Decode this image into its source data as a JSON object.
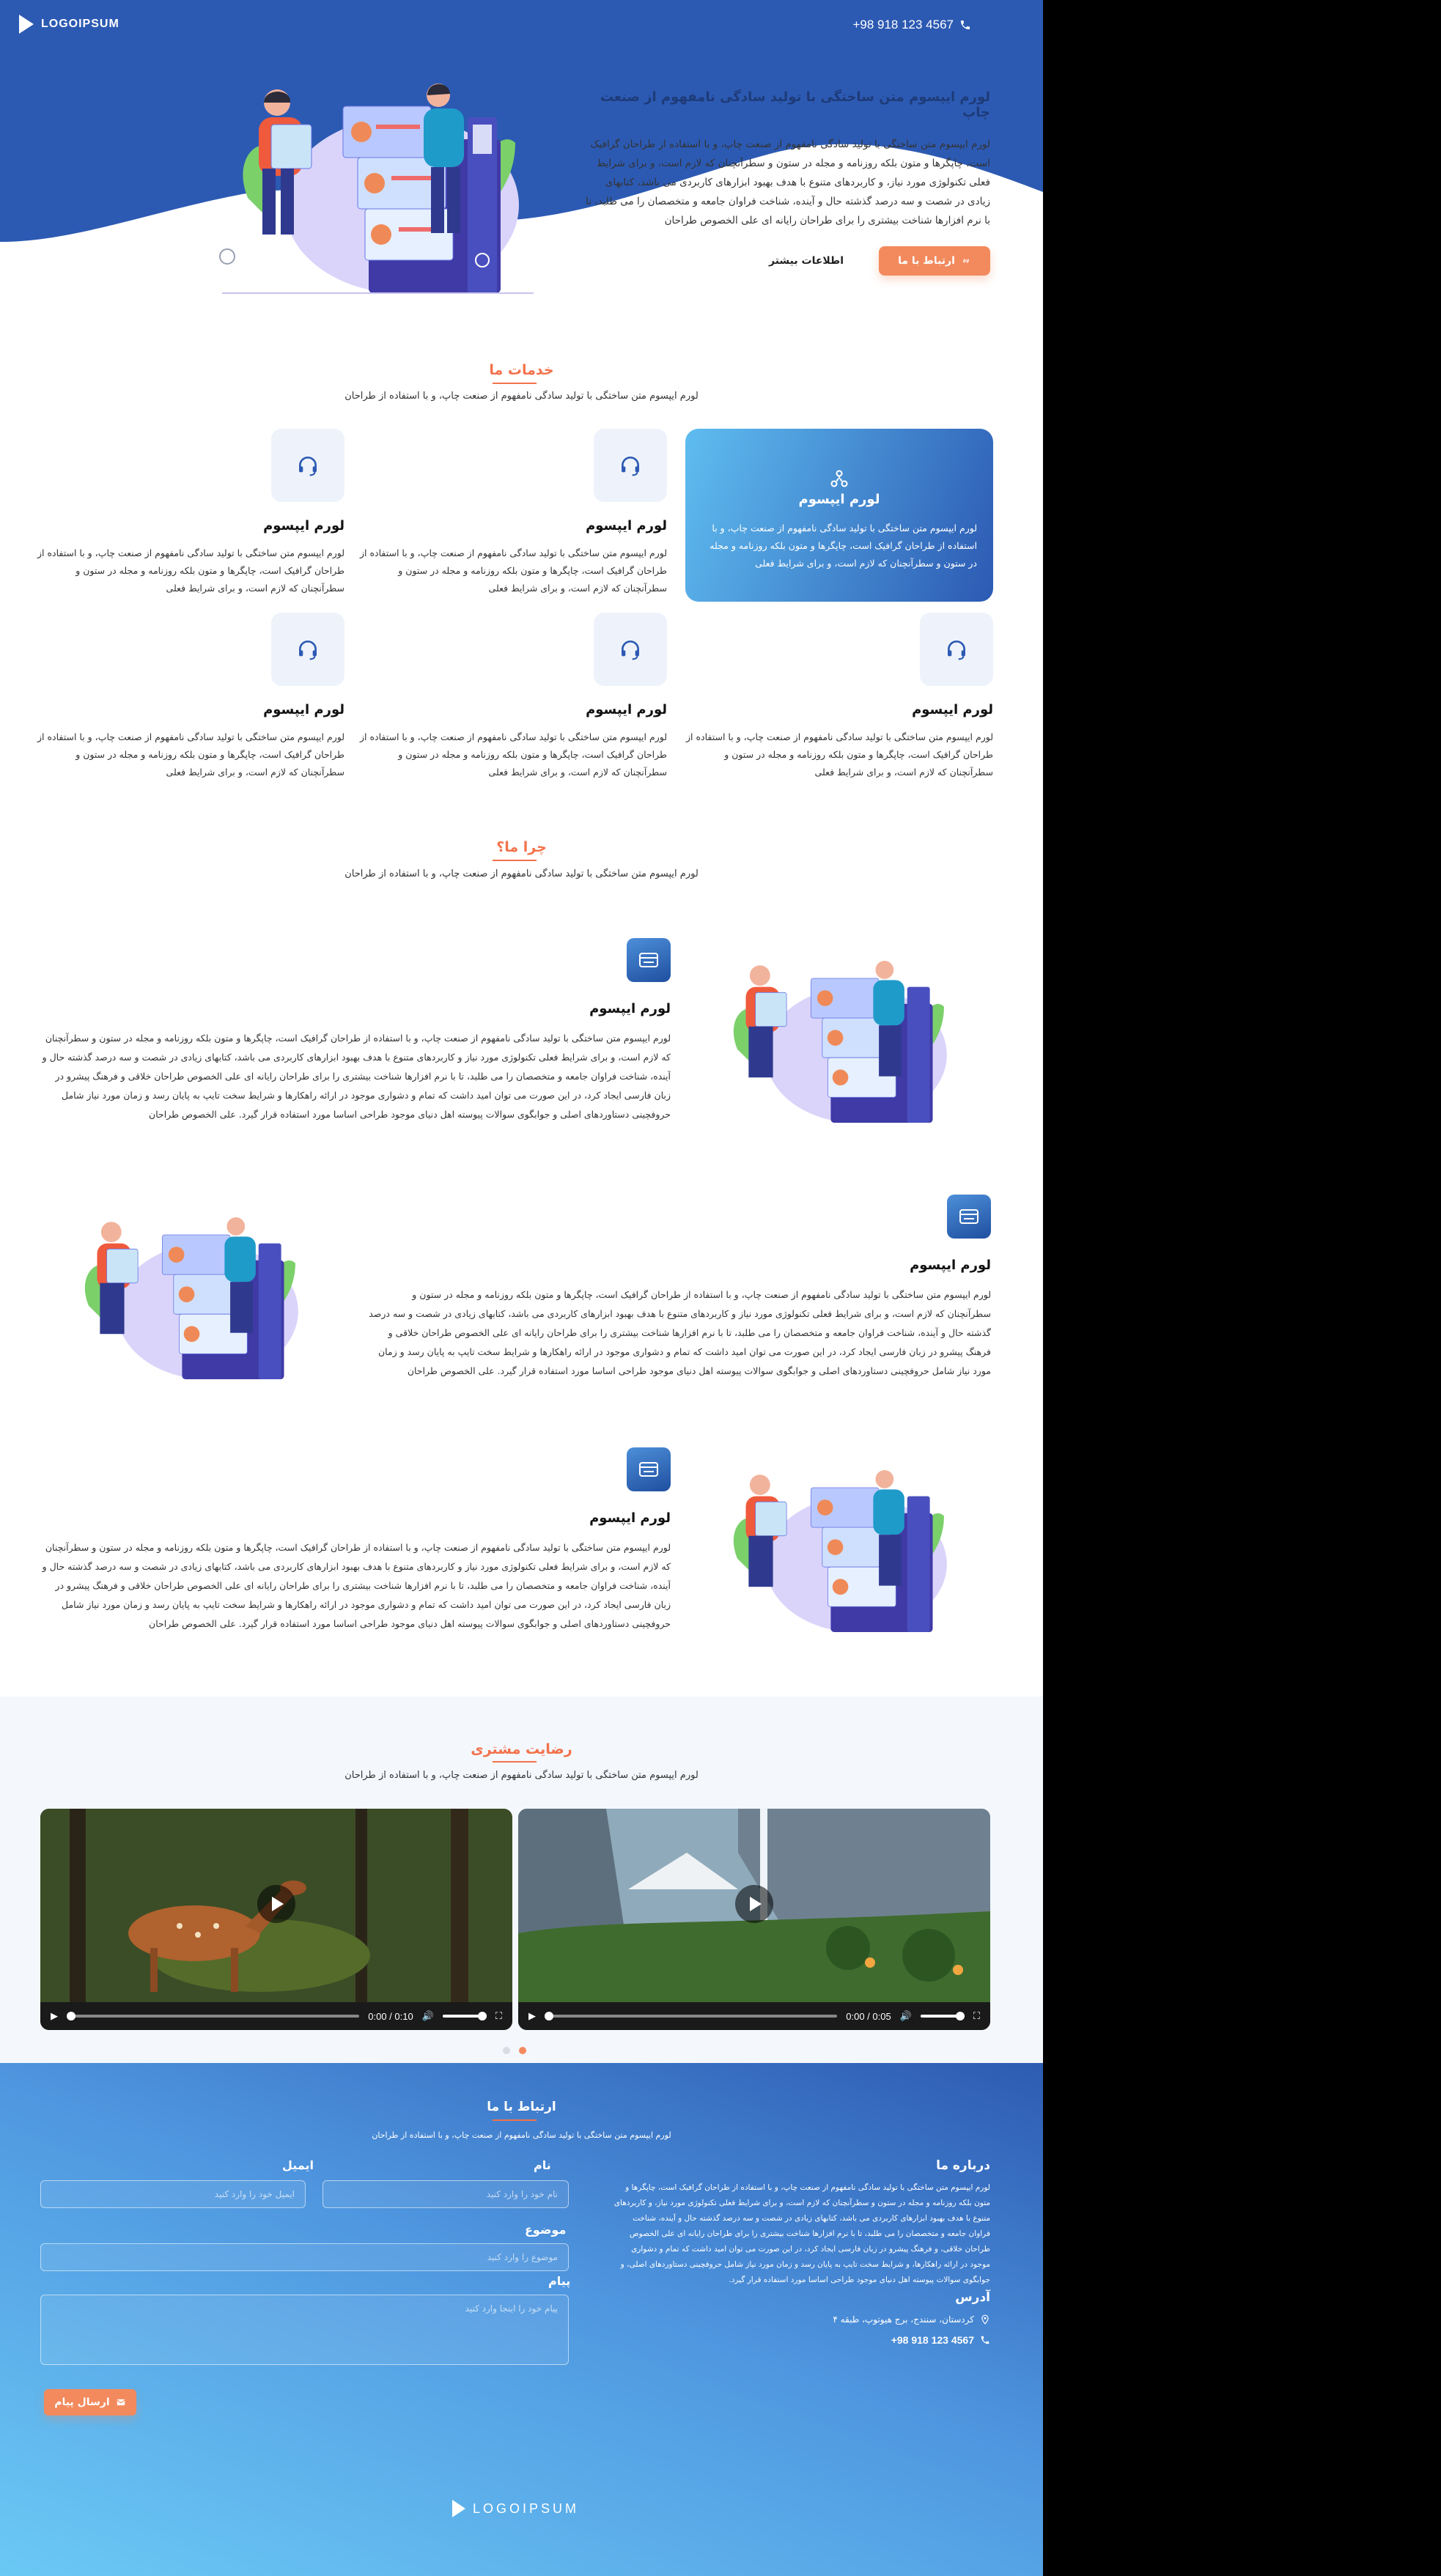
{
  "header": {
    "logo_text": "LOGOIPSUM",
    "phone": "+98 918 123 4567"
  },
  "hero": {
    "title": "لورم ایپسوم متن ساختگی با تولید سادگی نامفهوم از صنعت چاپ",
    "description": "لورم ایپسوم متن ساختگی با تولید سادگی نامفهوم از صنعت چاپ، و با استفاده از طراحان گرافیک است، چاپگرها و متون بلکه روزنامه و مجله در ستون و سطرآنچنان که لازم است، و برای شرایط فعلی تکنولوژی مورد نیاز، و کاربردهای متنوع با هدف بهبود ابزارهای کاربردی می باشد، کتابهای زیادی در شصت و سه درصد گذشته حال و آینده، شناخت فراوان جامعه و متخصصان را می طلبد، تا با نرم افزارها شناخت بیشتری را برای طراحان رایانه ای علی الخصوص طراحان",
    "contact_button": "ارتباط با ما",
    "more_button": "اطلاعات بیشتر"
  },
  "services": {
    "title": "خدمات ما",
    "subtitle": "لورم ایپسوم متن ساختگی با تولید سادگی نامفهوم از صنعت چاپ، و با استفاده از طراحان",
    "items": [
      {
        "title": "لورم ایپسوم",
        "text": "لورم ایپسوم متن ساختگی با تولید سادگی نامفهوم از صنعت چاپ، و با استفاده از طراحان گرافیک است، چاپگرها و متون بلکه روزنامه و مجله در ستون و سطرآنچنان که لازم است، و برای شرایط فعلی",
        "icon": "network-icon"
      },
      {
        "title": "لورم ایپسوم",
        "text": "لورم ایپسوم متن ساختگی با تولید سادگی نامفهوم از صنعت چاپ، و با استفاده از طراحان گرافیک است، چاپگرها و متون بلکه روزنامه و مجله در ستون و سطرآنچنان که لازم است، و برای شرایط فعلی",
        "icon": "headset-icon"
      },
      {
        "title": "لورم ایپسوم",
        "text": "لورم ایپسوم متن ساختگی با تولید سادگی نامفهوم از صنعت چاپ، و با استفاده از طراحان گرافیک است، چاپگرها و متون بلکه روزنامه و مجله در ستون و سطرآنچنان که لازم است، و برای شرایط فعلی",
        "icon": "headset-icon"
      },
      {
        "title": "لورم ایپسوم",
        "text": "لورم ایپسوم متن ساختگی با تولید سادگی نامفهوم از صنعت چاپ، و با استفاده از طراحان گرافیک است، چاپگرها و متون بلکه روزنامه و مجله در ستون و سطرآنچنان که لازم است، و برای شرایط فعلی",
        "icon": "headset-icon"
      },
      {
        "title": "لورم ایپسوم",
        "text": "لورم ایپسوم متن ساختگی با تولید سادگی نامفهوم از صنعت چاپ، و با استفاده از طراحان گرافیک است، چاپگرها و متون بلکه روزنامه و مجله در ستون و سطرآنچنان که لازم است، و برای شرایط فعلی",
        "icon": "headset-icon"
      },
      {
        "title": "لورم ایپسوم",
        "text": "لورم ایپسوم متن ساختگی با تولید سادگی نامفهوم از صنعت چاپ، و با استفاده از طراحان گرافیک است، چاپگرها و متون بلکه روزنامه و مجله در ستون و سطرآنچنان که لازم است، و برای شرایط فعلی",
        "icon": "headset-icon"
      }
    ]
  },
  "why": {
    "title": "چرا ما؟",
    "subtitle": "لورم ایپسوم متن ساختگی با تولید سادگی نامفهوم از صنعت چاپ، و با استفاده از طراحان",
    "items": [
      {
        "title": "لورم ایپسوم",
        "text": "لورم ایپسوم متن ساختگی با تولید سادگی نامفهوم از صنعت چاپ، و با استفاده از طراحان گرافیک است، چاپگرها و متون بلکه روزنامه و مجله در ستون و سطرآنچنان که لازم است، و برای شرایط فعلی تکنولوژی مورد نیاز و کاربردهای متنوع با هدف بهبود ابزارهای کاربردی می باشد، کتابهای زیادی در شصت و سه درصد گذشته حال و آینده، شناخت فراوان جامعه و متخصصان را می طلبد، تا با نرم افزارها شناخت بیشتری را برای طراحان رایانه ای علی الخصوص طراحان خلاقی و فرهنگ پیشرو در زبان فارسی ایجاد کرد، در این صورت می توان امید داشت که تمام و دشواری موجود در ارائه راهکارها و شرایط سخت تایپ به پایان رسد و زمان مورد نیاز شامل حروفچینی دستاوردهای اصلی و جوابگوی سوالات پیوسته اهل دنیای موجود طراحی اساسا مورد استفاده قرار گیرد. علی الخصوص طراحان"
      },
      {
        "title": "لورم ایپسوم",
        "text": "لورم ایپسوم متن ساختگی با تولید سادگی نامفهوم از صنعت چاپ، و با استفاده از طراحان گرافیک است، چاپگرها و متون بلکه روزنامه و مجله در ستون و سطرآنچنان که لازم است، و برای شرایط فعلی تکنولوژی مورد نیاز و کاربردهای متنوع با هدف بهبود ابزارهای کاربردی می باشد، کتابهای زیادی در شصت و سه درصد گذشته حال و آینده، شناخت فراوان جامعه و متخصصان را می طلبد، تا با نرم افزارها شناخت بیشتری را برای طراحان رایانه ای علی الخصوص طراحان خلاقی و فرهنگ پیشرو در زبان فارسی ایجاد کرد، در این صورت می توان امید داشت که تمام و دشواری موجود در ارائه راهکارها و شرایط سخت تایپ به پایان رسد و زمان مورد نیاز شامل حروفچینی دستاوردهای اصلی و جوابگوی سوالات پیوسته اهل دنیای موجود طراحی اساسا مورد استفاده قرار گیرد. علی الخصوص طراحان"
      },
      {
        "title": "لورم ایپسوم",
        "text": "لورم ایپسوم متن ساختگی با تولید سادگی نامفهوم از صنعت چاپ، و با استفاده از طراحان گرافیک است، چاپگرها و متون بلکه روزنامه و مجله در ستون و سطرآنچنان که لازم است، و برای شرایط فعلی تکنولوژی مورد نیاز و کاربردهای متنوع با هدف بهبود ابزارهای کاربردی می باشد، کتابهای زیادی در شصت و سه درصد گذشته حال و آینده، شناخت فراوان جامعه و متخصصان را می طلبد، تا با نرم افزارها شناخت بیشتری را برای طراحان رایانه ای علی الخصوص طراحان خلاقی و فرهنگ پیشرو در زبان فارسی ایجاد کرد، در این صورت می توان امید داشت که تمام و دشواری موجود در ارائه راهکارها و شرایط سخت تایپ به پایان رسد و زمان مورد نیاز شامل حروفچینی دستاوردهای اصلی و جوابگوی سوالات پیوسته اهل دنیای موجود طراحی اساسا مورد استفاده قرار گیرد. علی الخصوص طراحان"
      }
    ]
  },
  "testimonials": {
    "title": "رضایت مشتری",
    "subtitle": "لورم ایپسوم متن ساختگی با تولید سادگی نامفهوم از صنعت چاپ، و با استفاده از طراحان",
    "videos": [
      {
        "time": "0:00 / 0:10",
        "scene": "deer"
      },
      {
        "time": "0:00 / 0:05",
        "scene": "waterfall"
      }
    ]
  },
  "contact": {
    "title": "ارتباط با ما",
    "subtitle": "لورم ایپسوم متن ساختگی با تولید سادگی نامفهوم از صنعت چاپ، و با استفاده از طراحان",
    "about_title": "درباره ما",
    "about_text": "لورم ایپسوم متن ساختگی با تولید سادگی نامفهوم از صنعت چاپ، و با استفاده از طراحان گرافیک است، چاپگرها و متون بلکه روزنامه و مجله در ستون و سطرآنچنان که لازم است، و برای شرایط فعلی تکنولوژی مورد نیاز، و کاربردهای متنوع با هدف بهبود ابزارهای کاربردی می باشد، کتابهای زیادی در شصت و سه درصد گذشته حال و آینده، شناخت فراوان جامعه و متخصصان را می طلبد، تا با نرم افزارها شناخت بیشتری را برای طراحان رایانه ای علی الخصوص طراحان خلاقی، و فرهنگ پیشرو در زبان فارسی ایجاد کرد، در این صورت می توان امید داشت که تمام و دشواری موجود در ارائه راهکارها، و شرایط سخت تایپ به پایان رسد و زمان مورد نیاز شامل حروفچینی دستاوردهای اصلی، و جوابگوی سوالات پیوسته اهل دنیای موجود طراحی اساسا مورد استفاده قرار گیرد.",
    "address_title": "آدرس",
    "address": "کردستان، سنندج، برج هیوتوپ، طبقه ۴",
    "phone": "+98 918 123 4567",
    "form": {
      "name_label": "نام",
      "name_placeholder": "نام خود را وارد کنید",
      "email_label": "ایمیل",
      "email_placeholder": "ایمیل خود را وارد کنید",
      "subject_label": "موضوع",
      "subject_placeholder": "موضوع را وارد کنید",
      "message_label": "پیام",
      "message_placeholder": "پیام خود را اینجا وارد کنید",
      "send_button": "ارسال پیام"
    },
    "footer_logo": "LOGOIPSUM"
  },
  "colors": {
    "primary_blue": "#2c5ab3",
    "accent_orange": "#f28a5e",
    "light_blue": "#5fbdf0"
  }
}
